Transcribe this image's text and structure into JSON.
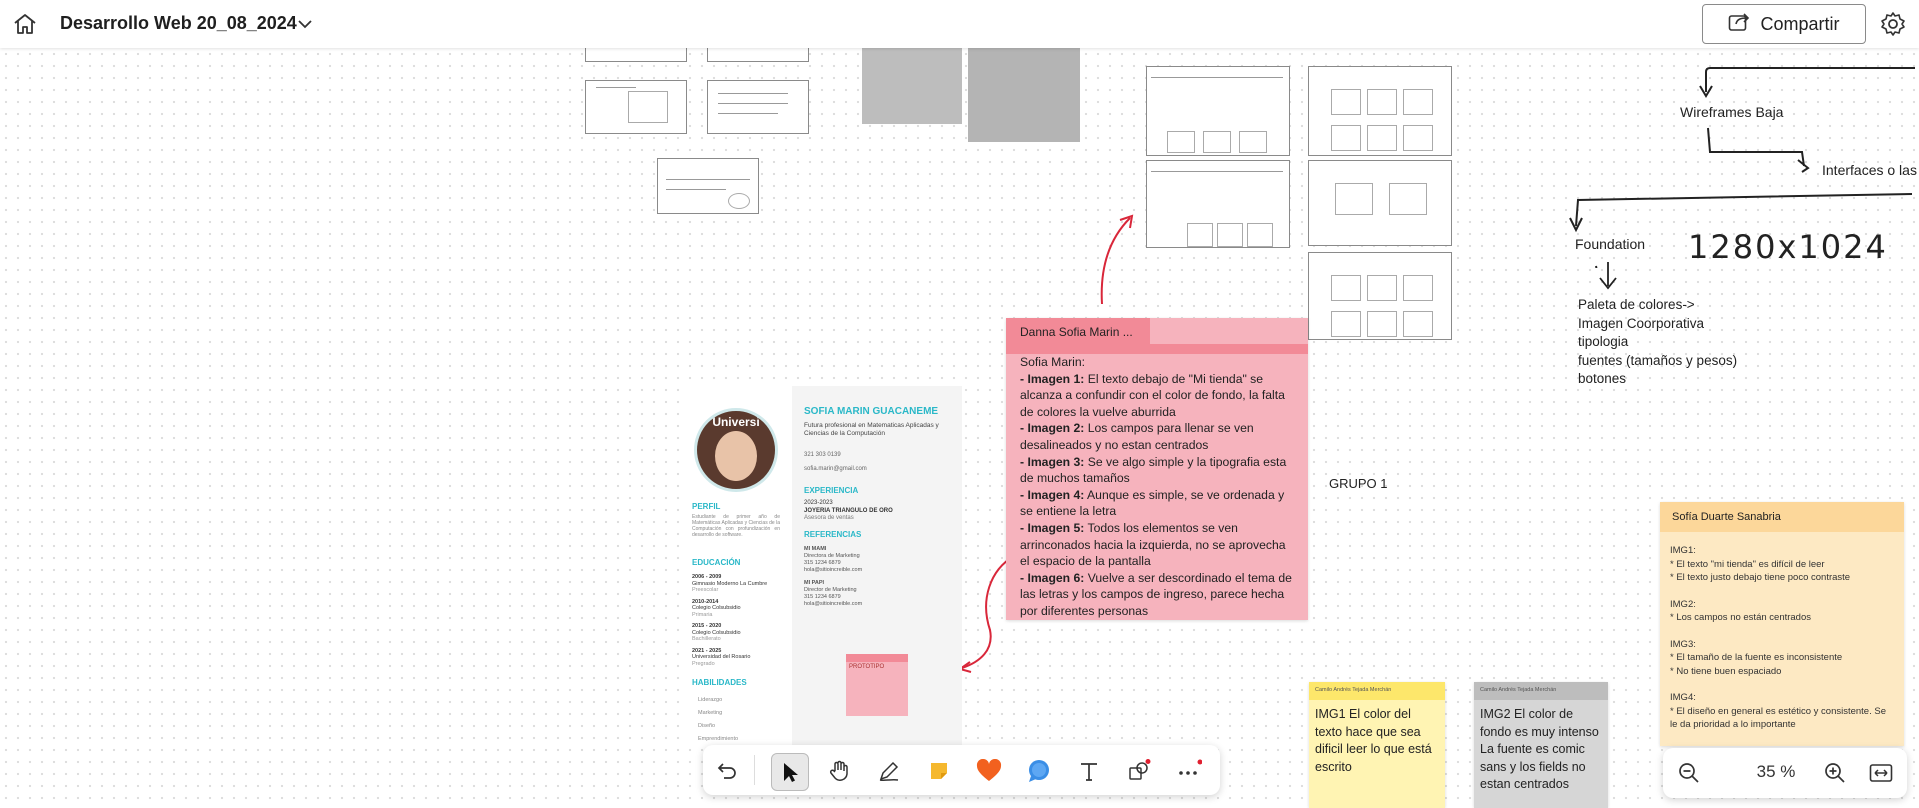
{
  "header": {
    "board_title": "Desarrollo Web 20_08_2024",
    "share_label": "Compartir",
    "icons": [
      "home-icon",
      "chevron-down-icon",
      "share-icon",
      "gear-icon"
    ]
  },
  "flow": {
    "wireframes": "Wireframes Baja",
    "interfaces": "Interfaces o las ",
    "foundation": "Foundation",
    "resolution": "1280x1024",
    "foundation_list": [
      "Paleta de colores->",
      "Imagen Coorporativa",
      "tipologia",
      "fuentes (tamaños y pesos)",
      "botones"
    ]
  },
  "group_label": "GRUPO 1",
  "sticky_danna": {
    "author": "Danna Sofia Marin ...",
    "intro": "Sofia Marin:",
    "items": [
      {
        "label": "- Imagen 1:",
        "text": " El texto debajo de \"Mi tienda\" se alcanza a confundir con el color de fondo,  la falta de colores la vuelve aburrida"
      },
      {
        "label": "- Imagen 2:",
        "text": " Los campos para llenar se ven desalineados y no estan centrados"
      },
      {
        "label": "- Imagen 3:",
        "text": " Se ve algo simple y la tipografia esta de muchos tamaños"
      },
      {
        "label": "- Imagen 4:",
        "text": " Aunque es simple, se ve ordenada y se entiene la letra"
      },
      {
        "label": "- Imagen 5:",
        "text": " Todos los elementos se ven arrinconados hacia la izquierda, no se aprovecha el espacio de la pantalla"
      },
      {
        "label": "- Imagen 6:",
        "text": " Vuelve a ser descordinado el tema de las letras y los campos de ingreso, parece hecha por diferentes personas"
      }
    ]
  },
  "sticky_sofia": {
    "author": "Sofía Duarte Sanabria",
    "lines": [
      "IMG1:",
      "* El texto \"mi tienda\" es difícil de leer",
      "* El texto justo debajo tiene poco contraste",
      "",
      "IMG2:",
      "* Los campos no están centrados",
      "",
      "IMG3:",
      "* El tamaño de la fuente es inconsistente",
      "* No tiene buen espaciado",
      "",
      "IMG4:",
      "* El diseño en general es estético y consistente. Se le da prioridad a lo importante"
    ]
  },
  "sticky_camilo1": {
    "author": "Camilo Andrés Tejada Merchán",
    "text": "IMG1 El color del texto hace que sea dificil leer lo que está escrito"
  },
  "sticky_camilo2": {
    "author": "Camilo Andrés Tejada Merchán",
    "text": "IMG2 El color de fondo es muy intenso La fuente es comic sans y los fields no estan centrados"
  },
  "cv": {
    "name": "SOFIA MARIN GUACANEME",
    "subtitle": "Futura profesional en Matematicas Aplicadas y Ciencias de la Computación",
    "phone": "321 303 0139",
    "email": "sofia.marin@gmail.com",
    "perfil_title": "PERFIL",
    "perfil_text": "Estudiante de primer año de Matemáticas Aplicadas y Ciencias de la Computación con profundización en desarrollo de software.",
    "educacion_title": "EDUCACIÓN",
    "educacion": [
      {
        "years": "2006 - 2009",
        "school": "Gimnasio Moderno La Cumbre",
        "level": "Preescolar"
      },
      {
        "years": "2010-2014",
        "school": "Colegio Colsubsidio",
        "level": "Primaria"
      },
      {
        "years": "2015 - 2020",
        "school": "Colegio Colsubsidio",
        "level": "Bachillerato"
      },
      {
        "years": "2021 - 2025",
        "school": "Universidad del Rosario",
        "level": "Pregrado"
      }
    ],
    "habilidades_title": "HABILIDADES",
    "habilidades": [
      "Liderazgo",
      "Marketing",
      "Diseño",
      "Emprendimiento"
    ],
    "experiencia_title": "EXPERIENCIA",
    "experiencia": {
      "years": "2023-2023",
      "place": "JOYERIA TRIANGULO DE ORO",
      "role": "Asesora de ventas"
    },
    "referencias_title": "REFERENCIAS",
    "referencias": [
      {
        "name": "MI MAMI",
        "role": "Directora de Marketing",
        "phone": "315 1234 6879",
        "email": "hola@sitioincreible.com"
      },
      {
        "name": "MI PAPI",
        "role": "Director de Marketing",
        "phone": "315 1234 6879",
        "email": "hola@sitioincreible.com"
      }
    ],
    "photo_text": "Universi",
    "mini_note": "PROTOTIPO"
  },
  "zoom": {
    "level": "35 %"
  },
  "toolbar_tools": [
    "undo",
    "select",
    "hand",
    "pen",
    "sticky-note",
    "reaction",
    "comment",
    "text",
    "shapes",
    "more"
  ],
  "colors": {
    "accent_teal": "#2ab8c8",
    "pink_note": "#f6b3bd",
    "pink_header": "#f28a97",
    "yellow_note": "#fde9c3",
    "yellow_header": "#fcd79a",
    "arrow_red": "#d9273a"
  }
}
